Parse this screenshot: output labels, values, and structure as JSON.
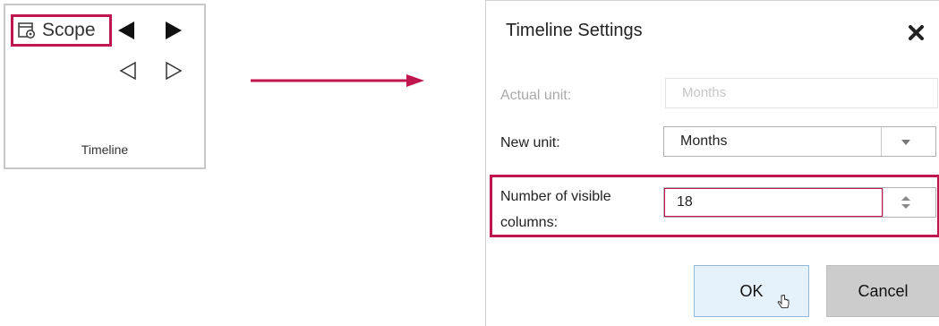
{
  "ribbon": {
    "scope_label": "Scope",
    "group_label": "Timeline",
    "icons": [
      "scope-settings-icon",
      "prev-filled-triangle-icon",
      "next-filled-triangle-icon",
      "prev-outline-triangle-icon",
      "next-outline-triangle-icon"
    ]
  },
  "dialog": {
    "title": "Timeline Settings",
    "actual_unit": {
      "label": "Actual unit:",
      "value": "Months"
    },
    "new_unit": {
      "label": "New unit:",
      "value": "Months"
    },
    "visible_columns": {
      "label_line1": "Number of visible",
      "label_line2": "columns:",
      "value": "18"
    },
    "ok_label": "OK",
    "cancel_label": "Cancel"
  },
  "colors": {
    "highlight": "#c0164e",
    "ok_button_bg": "#e5f1fb",
    "cancel_button_bg": "#cccccc"
  }
}
